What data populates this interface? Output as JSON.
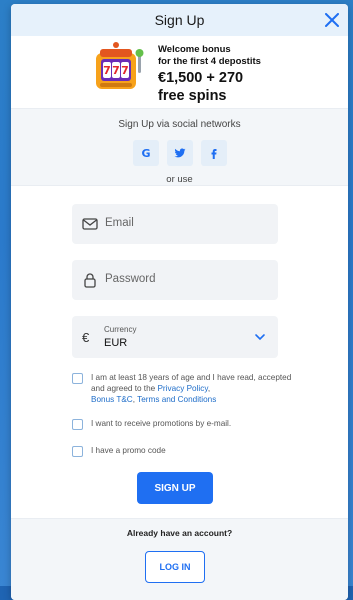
{
  "modal": {
    "title": "Sign Up"
  },
  "bonus": {
    "line1": "Welcome bonus",
    "line2": "for the first 4 depostits",
    "amount": "€1,500  + 270",
    "spins": "free spins",
    "slot_digits": "777"
  },
  "social": {
    "title": "Sign Up via social networks",
    "buttons": [
      "G",
      "t",
      "f"
    ],
    "or_use": "or use"
  },
  "form": {
    "email_placeholder": "Email",
    "password_placeholder": "Password",
    "currency_label": "Currency",
    "currency_value": "EUR",
    "currency_symbol": "€"
  },
  "checks": {
    "age_text_before": "I am at least 18 years of age and I have read, accepted and agreed to the ",
    "privacy_link": "Privacy Policy",
    "comma": ",",
    "bonus_link": "Bonus T&C",
    "comma2": ",",
    "terms_link": "Terms and Conditions",
    "promotions": "I want to receive promotions by e-mail.",
    "promo_code": "I have a promo code"
  },
  "actions": {
    "signup": "SIGN UP",
    "already": "Already have an account?",
    "login": "LOG IN"
  },
  "colors": {
    "accent": "#1f6ff2",
    "header_bg": "#e6f1fb",
    "link": "#1e6dc9"
  },
  "icons": {
    "close": "close-icon",
    "google": "google-icon",
    "twitter": "twitter-icon",
    "facebook": "facebook-icon",
    "email": "mail-icon",
    "password": "lock-icon",
    "currency": "euro-icon",
    "dropdown": "chevron-down-icon"
  }
}
